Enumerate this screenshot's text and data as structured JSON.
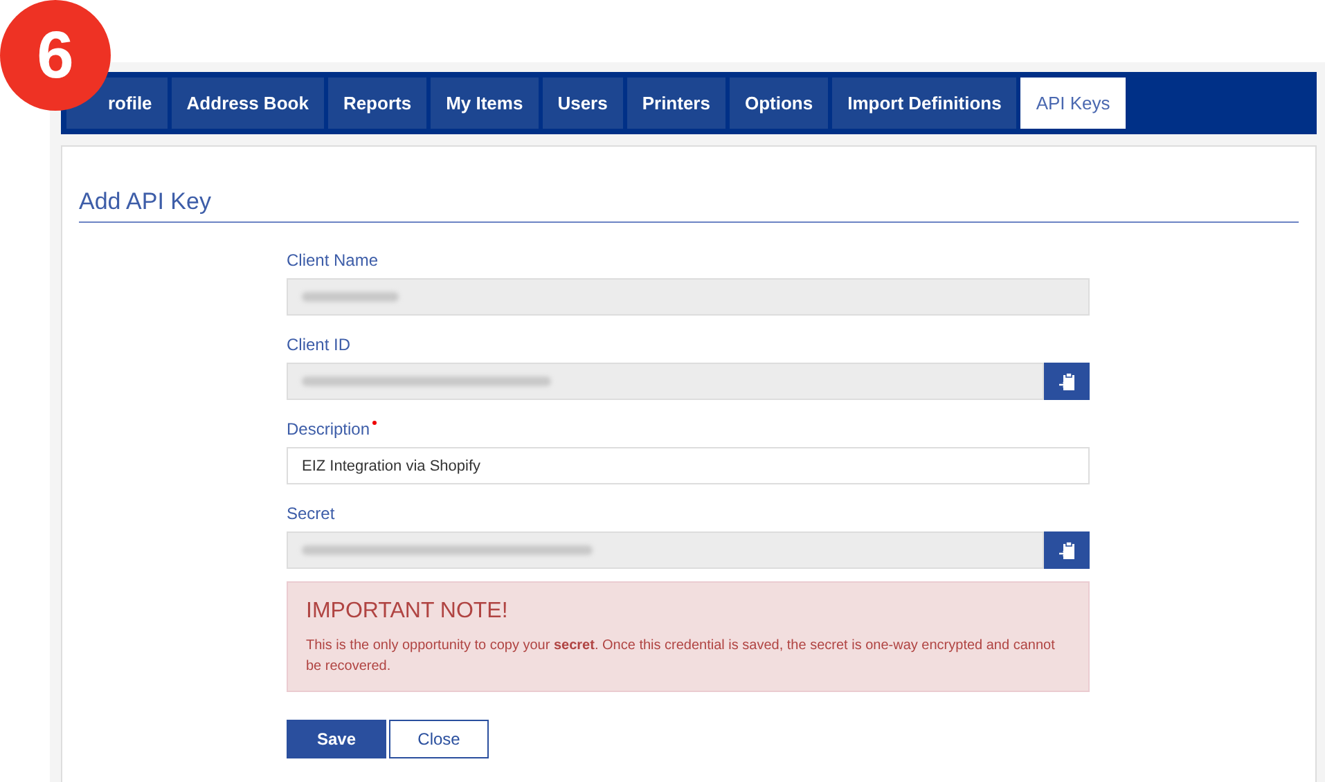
{
  "step_badge": "6",
  "tabs": [
    {
      "label": "rofile",
      "selected": false
    },
    {
      "label": "Address Book",
      "selected": false
    },
    {
      "label": "Reports",
      "selected": false
    },
    {
      "label": "My Items",
      "selected": false
    },
    {
      "label": "Users",
      "selected": false
    },
    {
      "label": "Printers",
      "selected": false
    },
    {
      "label": "Options",
      "selected": false
    },
    {
      "label": "Import Definitions",
      "selected": false
    },
    {
      "label": "API Keys",
      "selected": true
    }
  ],
  "heading": "Add API Key",
  "fields": [
    {
      "label": "Client Name",
      "kind": "readonly",
      "required": false,
      "copy": false
    },
    {
      "label": "Client ID",
      "kind": "readonly",
      "required": false,
      "copy": true
    },
    {
      "label": "Description",
      "kind": "input",
      "required": true,
      "copy": false,
      "value": "EIZ Integration via Shopify"
    },
    {
      "label": "Secret",
      "kind": "readonly",
      "required": false,
      "copy": true
    }
  ],
  "note": {
    "title": "IMPORTANT NOTE!",
    "text": "This is the only opportunity to copy your **secret**. Once this credential is saved, the secret is one-way encrypted and cannot be recovered."
  },
  "buttons": [
    {
      "label": "Save",
      "kind": "primary"
    },
    {
      "label": "Close",
      "kind": "secondary"
    }
  ]
}
